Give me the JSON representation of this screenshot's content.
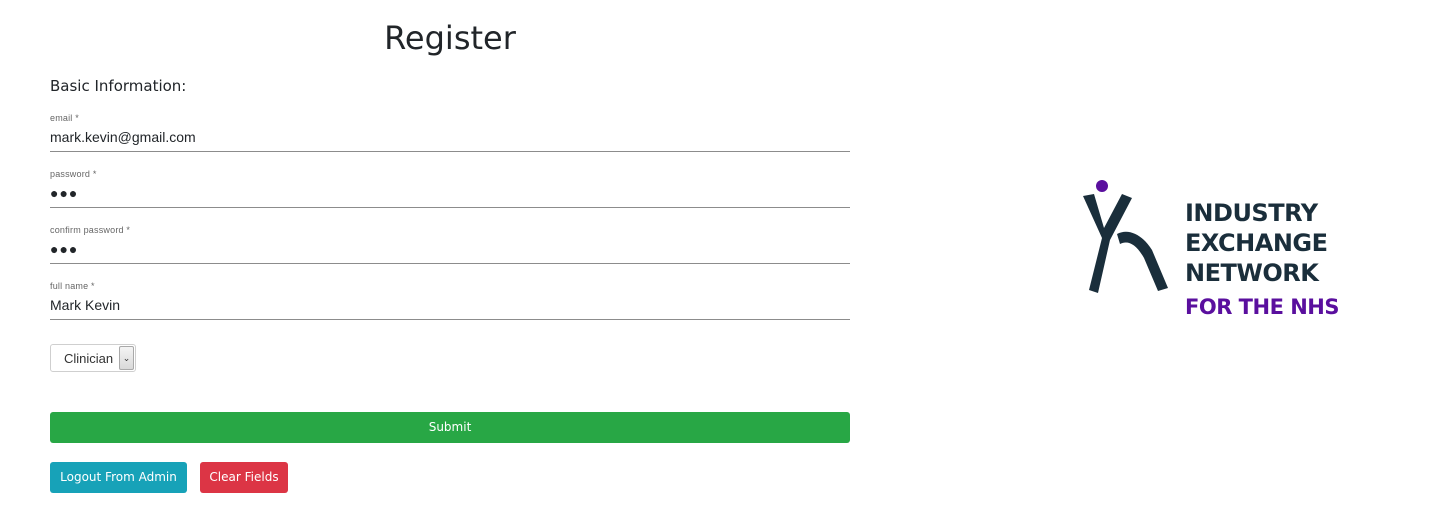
{
  "page": {
    "title": "Register",
    "section_label": "Basic Information:"
  },
  "form": {
    "email": {
      "label": "email *",
      "value": "mark.kevin@gmail.com"
    },
    "password": {
      "label": "password *",
      "masked": "●●●"
    },
    "confirm_password": {
      "label": "confirm password *",
      "masked": "●●●"
    },
    "full_name": {
      "label": "full name *",
      "value": "Mark Kevin"
    },
    "role": {
      "selected": "Clinician",
      "arrow": "⌄"
    }
  },
  "buttons": {
    "submit": "Submit",
    "logout": "Logout From Admin",
    "clear": "Clear Fields"
  },
  "logo": {
    "line1": "INDUSTRY",
    "line2": "EXCHANGE",
    "line3": "NETWORK",
    "line4": "FOR THE NHS",
    "colors": {
      "dark": "#1a2e3b",
      "purple": "#5a0f9e"
    }
  },
  "colors": {
    "submit": "#28a745",
    "logout": "#17a2b8",
    "clear": "#dc3545"
  }
}
